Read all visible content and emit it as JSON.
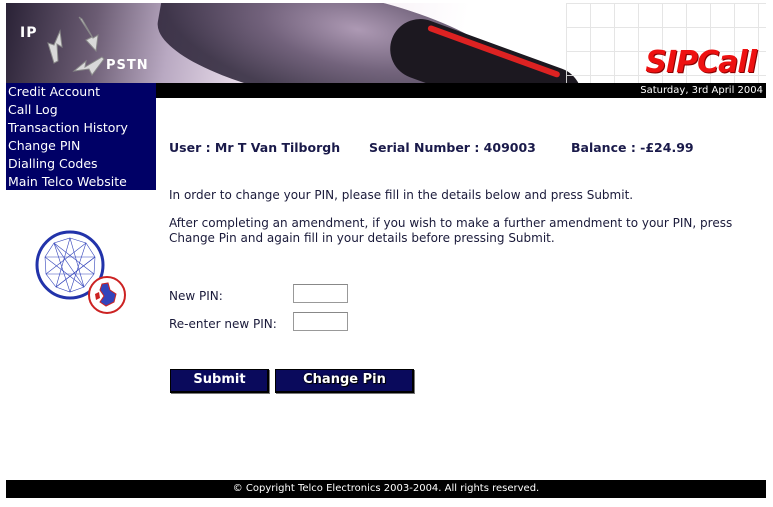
{
  "header": {
    "logo_top": "IP",
    "logo_bottom": "PSTN",
    "brand": "SIPCall",
    "date": "Saturday, 3rd April 2004"
  },
  "nav": {
    "items": [
      {
        "label": "Credit Account"
      },
      {
        "label": "Call Log"
      },
      {
        "label": "Transaction History"
      },
      {
        "label": "Change PIN"
      },
      {
        "label": "Dialling Codes"
      },
      {
        "label": "Main Telco Website"
      }
    ]
  },
  "account": {
    "user": "User : Mr T Van Tilborgh",
    "serial": "Serial Number : 409003",
    "balance": "Balance : -£24.99"
  },
  "instructions": {
    "line1": "In order to change your PIN, please fill in the details below and press Submit.",
    "line2": "After completing an amendment, if you wish to make a further amendment to your PIN, press Change Pin and again fill in your details before pressing Submit."
  },
  "form": {
    "new_pin_label": "New PIN:",
    "new_pin_value": "",
    "reenter_label": "Re-enter new PIN:",
    "reenter_value": "",
    "submit_label": "Submit",
    "change_pin_label": "Change Pin"
  },
  "footer": {
    "copyright": "© Copyright Telco Electronics 2003-2004. All rights reserved."
  },
  "colors": {
    "nav_bg": "#000066",
    "button_bg": "#0a0a5c",
    "brand_red": "#ee1111",
    "bar_black": "#000000"
  }
}
